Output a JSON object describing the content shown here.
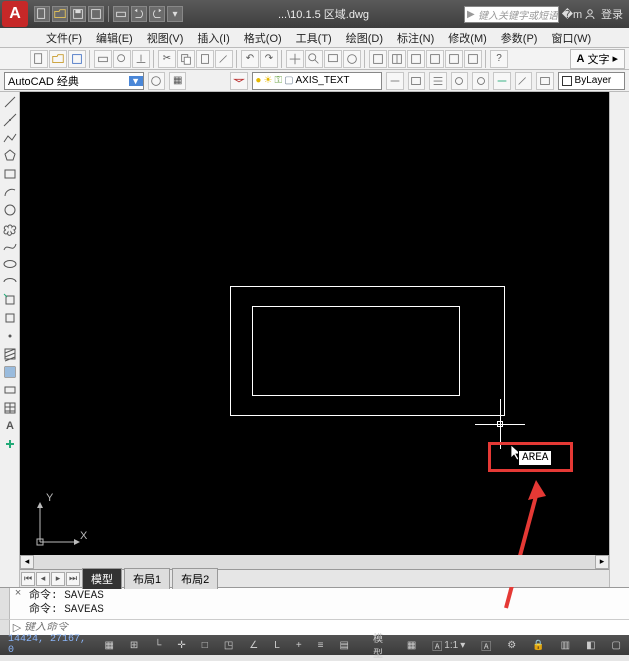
{
  "title": {
    "filename": "...\\10.1.5 区域.dwg"
  },
  "search": {
    "placeholder": "键入关键字或短语"
  },
  "user": {
    "login_label": "登录"
  },
  "menus": [
    {
      "label": "文件(F)"
    },
    {
      "label": "编辑(E)"
    },
    {
      "label": "视图(V)"
    },
    {
      "label": "插入(I)"
    },
    {
      "label": "格式(O)"
    },
    {
      "label": "工具(T)"
    },
    {
      "label": "绘图(D)"
    },
    {
      "label": "标注(N)"
    },
    {
      "label": "修改(M)"
    },
    {
      "label": "参数(P)"
    },
    {
      "label": "窗口(W)"
    }
  ],
  "panel_tab": {
    "label": "文字"
  },
  "workspace": {
    "value": "AutoCAD 经典"
  },
  "layer": {
    "current": "AXIS_TEXT"
  },
  "bylayer": {
    "label": "ByLayer"
  },
  "tabs": {
    "model": "模型",
    "layout1": "布局1",
    "layout2": "布局2"
  },
  "command": {
    "history_line1": "命令: SAVEAS",
    "history_line2": "命令: SAVEAS",
    "prompt_placeholder": "键入命令"
  },
  "dynamic_input": {
    "value": "AREA"
  },
  "ucs": {
    "x": "X",
    "y": "Y"
  },
  "status": {
    "coords": "14424, 27167, 0",
    "model": "模型",
    "scale": "1:1"
  },
  "left_tools": [
    "line",
    "construction-line",
    "polyline",
    "polygon",
    "rectangle",
    "arc",
    "circle",
    "revision-cloud",
    "spline",
    "ellipse",
    "ellipse-arc",
    "insert-block",
    "make-block",
    "point",
    "hatch",
    "gradient",
    "region",
    "table",
    "text",
    "add-selected"
  ]
}
